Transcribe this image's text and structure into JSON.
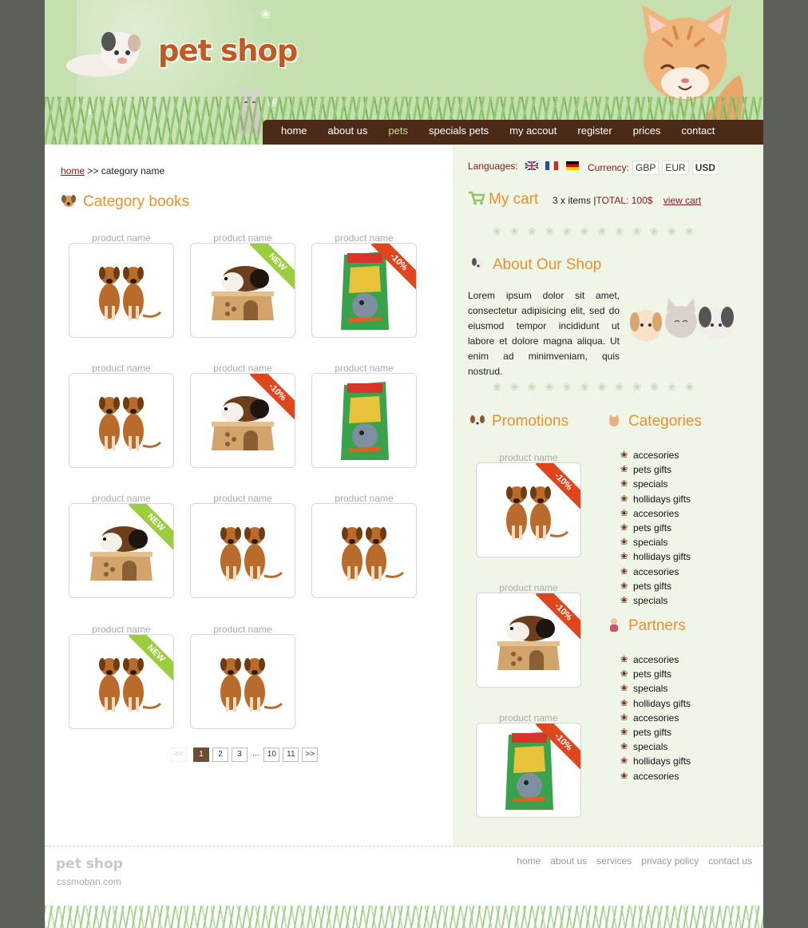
{
  "header": {
    "logo": "pet shop",
    "nav": [
      {
        "label": "home",
        "active": false
      },
      {
        "label": "about us",
        "active": false
      },
      {
        "label": "pets",
        "active": true
      },
      {
        "label": "specials pets",
        "active": false
      },
      {
        "label": "my accout",
        "active": false
      },
      {
        "label": "register",
        "active": false
      },
      {
        "label": "prices",
        "active": false
      },
      {
        "label": "contact",
        "active": false
      }
    ]
  },
  "breadcrumb": {
    "home": "home",
    "separator": ">>",
    "current": "category name"
  },
  "category": {
    "title": "Category books",
    "products": [
      {
        "name": "product name",
        "image": "dogs",
        "badge": ""
      },
      {
        "name": "product name",
        "image": "guinea-pig",
        "badge": "NEW"
      },
      {
        "name": "product name",
        "image": "food",
        "badge": "-10%"
      },
      {
        "name": "product name",
        "image": "dogs",
        "badge": ""
      },
      {
        "name": "product name",
        "image": "guinea-pig",
        "badge": "-10%"
      },
      {
        "name": "product name",
        "image": "food",
        "badge": ""
      },
      {
        "name": "product name",
        "image": "guinea-pig",
        "badge": "NEW"
      },
      {
        "name": "product name",
        "image": "dogs",
        "badge": ""
      },
      {
        "name": "product name",
        "image": "dogs",
        "badge": ""
      },
      {
        "name": "product name",
        "image": "dogs",
        "badge": "NEW"
      },
      {
        "name": "product name",
        "image": "dogs",
        "badge": ""
      }
    ],
    "pagination": {
      "prev": "<<",
      "pages": [
        "1",
        "2",
        "3"
      ],
      "dots": "...",
      "more": [
        "10",
        "11"
      ],
      "next": ">>",
      "current": "1"
    }
  },
  "sidebar": {
    "languages_label": "Languages:",
    "languages": [
      "en-flag",
      "fr-flag",
      "de-flag"
    ],
    "currency_label": "Currency:",
    "currencies": [
      {
        "code": "GBP",
        "selected": false
      },
      {
        "code": "EUR",
        "selected": false
      },
      {
        "code": "USD",
        "selected": true
      }
    ],
    "cart": {
      "title": "My cart",
      "items": "3 x items",
      "separator": "|",
      "total": "TOTAL: 100$",
      "link": "view cart"
    },
    "about": {
      "title": "About Our Shop",
      "text": "Lorem ipsum dolor sit amet, consectetur adipisicing elit, sed do eiusmod tempor incididunt ut labore et dolore magna aliqua. Ut enim ad minimveniam, quis nostrud."
    },
    "promotions": {
      "title": "Promotions",
      "items": [
        {
          "name": "product name",
          "image": "dogs",
          "badge": "-10%"
        },
        {
          "name": "product name",
          "image": "guinea-pig",
          "badge": "-10%"
        },
        {
          "name": "product name",
          "image": "food",
          "badge": "-10%"
        }
      ]
    },
    "categories": {
      "title": "Categories",
      "items": [
        "accesories",
        "pets gifts",
        "specials",
        "hollidays gifts",
        "accesories",
        "pets gifts",
        "specials",
        "hollidays gifts",
        "accesories",
        "pets gifts",
        "specials"
      ]
    },
    "partners": {
      "title": "Partners",
      "items": [
        "accesories",
        "pets gifts",
        "specials",
        "hollidays gifts",
        "accesories",
        "pets gifts",
        "specials",
        "hollidays gifts",
        "accesories"
      ]
    }
  },
  "footer": {
    "logo": "pet shop",
    "site": "cssmoban.com",
    "links": [
      "home",
      "about us",
      "services",
      "privacy policy",
      "contact us"
    ]
  },
  "colors": {
    "nav_bg": "#4b2b18",
    "accent": "#e9902e",
    "link": "#8c1414",
    "header_bg": "#c5dfaf",
    "sidebar_bg": "#eff6e8"
  }
}
